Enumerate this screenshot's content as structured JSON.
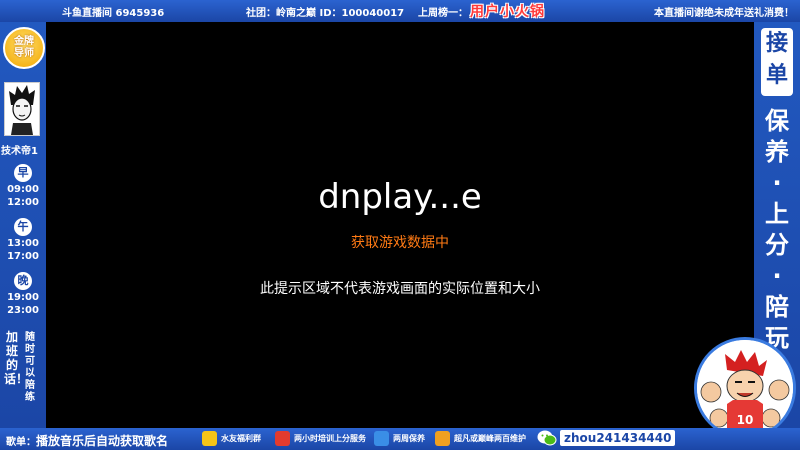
{
  "topbar": {
    "room": "斗鱼直播间 6945936",
    "guild": "社团：岭南之巅 ID：100040017",
    "rank_label": "上周榜一：",
    "rank_name": "用户小火锅",
    "notice": "本直播间谢绝未成年送礼消费！"
  },
  "left": {
    "badge_line1": "金牌",
    "badge_line2": "导师",
    "tech_name": "技术帝1",
    "schedule": [
      {
        "shift": "早",
        "start": "09:00",
        "end": "12:00"
      },
      {
        "shift": "午",
        "start": "13:00",
        "end": "17:00"
      },
      {
        "shift": "晚",
        "start": "19:00",
        "end": "23:00"
      }
    ],
    "overtime": "加班的话！",
    "anytime": "随时可以陪练"
  },
  "stage": {
    "title": "dnplay...e",
    "status": "获取游戏数据中",
    "tip": "此提示区域不代表游戏画面的实际位置和大小"
  },
  "right": {
    "accept": "接单",
    "services": [
      "保",
      "养",
      "·",
      "上",
      "分",
      "·",
      "陪",
      "玩"
    ]
  },
  "bottom": {
    "song_label": "歌单：",
    "song_text": "播放音乐后自动获取歌名",
    "links": [
      {
        "label": "水友福利群",
        "color": "#f5c518"
      },
      {
        "label": "两小时培训上分服务",
        "color": "#e33b2e"
      },
      {
        "label": "两周保养",
        "color": "#3a8ee6"
      },
      {
        "label": "超凡或巅峰两百维护",
        "color": "#f0a020"
      }
    ],
    "wechat": "zhou241434440"
  }
}
